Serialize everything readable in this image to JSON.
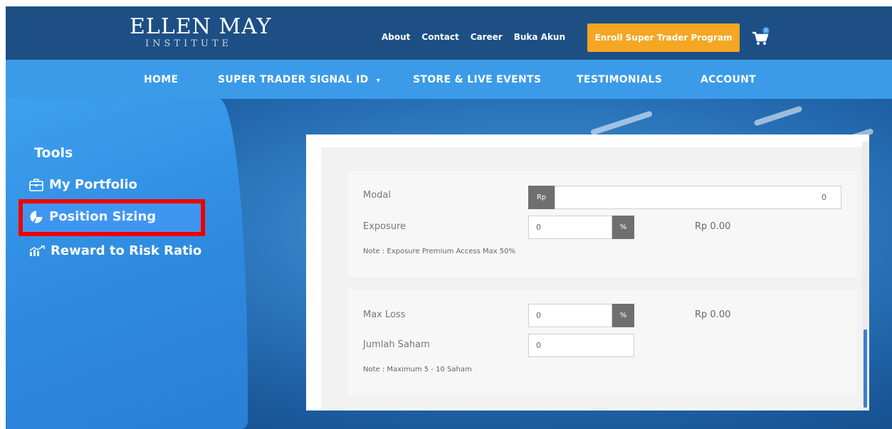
{
  "header": {
    "logo_main": "ELLEN MAY",
    "logo_sub": "INSTITUTE",
    "links": [
      "About",
      "Contact",
      "Career",
      "Buka Akun"
    ],
    "enroll_label": "Enroll Super Trader Program",
    "cart_count": "0"
  },
  "nav": {
    "home": "HOME",
    "signal": "SUPER TRADER SIGNAL ID",
    "store": "STORE & LIVE EVENTS",
    "testimonials": "TESTIMONIALS",
    "account": "ACCOUNT"
  },
  "sidebar": {
    "title": "Tools",
    "items": [
      {
        "label": "My Portfolio",
        "icon": "briefcase-icon"
      },
      {
        "label": "Position Sizing",
        "icon": "pie-chart-icon"
      },
      {
        "label": "Reward to Risk Ratio",
        "icon": "chart-icon"
      }
    ]
  },
  "form": {
    "modal_label": "Modal",
    "modal_prefix": "Rp",
    "modal_value": "0",
    "exposure_label": "Exposure",
    "exposure_value": "0",
    "exposure_suffix": "%",
    "exposure_result": "Rp 0.00",
    "exposure_note": "Note : Exposure Premium Access Max 50%",
    "maxloss_label": "Max Loss",
    "maxloss_value": "0",
    "maxloss_suffix": "%",
    "maxloss_result": "Rp 0.00",
    "jumlah_label": "Jumlah Saham",
    "jumlah_value": "0",
    "jumlah_note": "Note : Maximum 5 - 10 Saham"
  },
  "colors": {
    "topbar": "#1d4f85",
    "nav": "#3b9be9",
    "enroll": "#f5a623",
    "highlight": "#ee0000"
  }
}
